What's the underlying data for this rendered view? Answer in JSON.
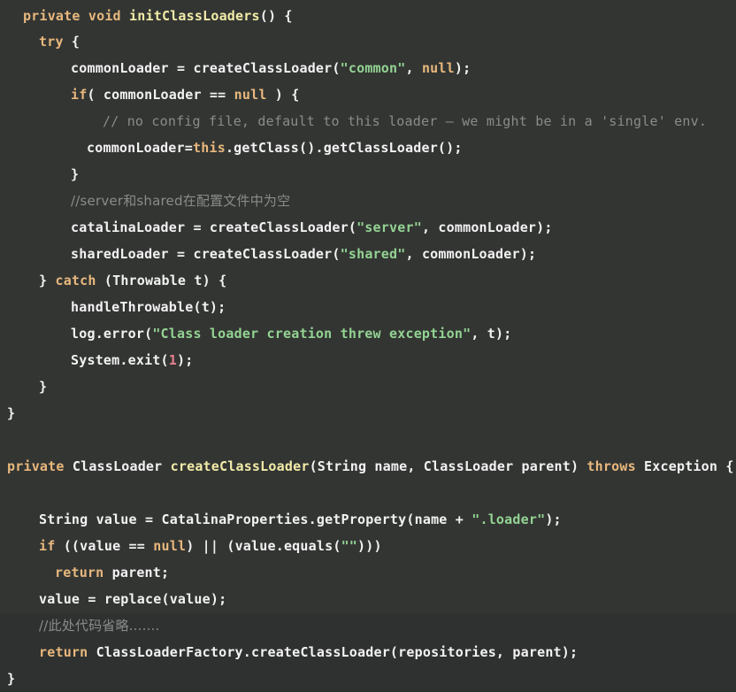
{
  "editor": {
    "background_color": "#333533",
    "language": "java",
    "theme_colors": {
      "keyword": "#e8b87d",
      "function": "#f2eca8",
      "string": "#93d393",
      "number": "#e8808f",
      "comment": "#8a8c8a",
      "plain": "#f2f2f2"
    }
  },
  "code": {
    "lines": [
      {
        "id": "line-1",
        "indent": 1,
        "tokens": [
          {
            "t": "private",
            "c": "kw"
          },
          {
            "t": " ",
            "c": "plain"
          },
          {
            "t": "void",
            "c": "kw"
          },
          {
            "t": " ",
            "c": "plain"
          },
          {
            "t": "initClassLoaders",
            "c": "fn"
          },
          {
            "t": "() {",
            "c": "plain"
          }
        ]
      },
      {
        "id": "line-2",
        "indent": 2,
        "tokens": [
          {
            "t": "try",
            "c": "kw"
          },
          {
            "t": " {",
            "c": "plain"
          }
        ]
      },
      {
        "id": "line-3",
        "indent": 4,
        "tokens": [
          {
            "t": "commonLoader = createClassLoader(",
            "c": "plain"
          },
          {
            "t": "\"common\"",
            "c": "str"
          },
          {
            "t": ", ",
            "c": "plain"
          },
          {
            "t": "null",
            "c": "kw"
          },
          {
            "t": ");",
            "c": "plain"
          }
        ]
      },
      {
        "id": "line-4",
        "indent": 4,
        "tokens": [
          {
            "t": "if",
            "c": "kw"
          },
          {
            "t": "( commonLoader == ",
            "c": "plain"
          },
          {
            "t": "null",
            "c": "kw"
          },
          {
            "t": " ) {",
            "c": "plain"
          }
        ]
      },
      {
        "id": "line-5",
        "indent": 6,
        "tokens": [
          {
            "t": "// no config file, default to this loader – we might be in a 'single' env.",
            "c": "cmt"
          }
        ]
      },
      {
        "id": "line-6",
        "indent": 5,
        "tokens": [
          {
            "t": "commonLoader=",
            "c": "plain"
          },
          {
            "t": "this",
            "c": "kw"
          },
          {
            "t": ".getClass().getClassLoader();",
            "c": "plain"
          }
        ]
      },
      {
        "id": "line-7",
        "indent": 4,
        "tokens": [
          {
            "t": "}",
            "c": "plain"
          }
        ]
      },
      {
        "id": "line-8",
        "indent": 4,
        "tokens": [
          {
            "t": "//server和shared在配置文件中为空",
            "c": "cmt-cjk"
          }
        ]
      },
      {
        "id": "line-9",
        "indent": 4,
        "tokens": [
          {
            "t": "catalinaLoader = createClassLoader(",
            "c": "plain"
          },
          {
            "t": "\"server\"",
            "c": "str"
          },
          {
            "t": ", commonLoader);",
            "c": "plain"
          }
        ]
      },
      {
        "id": "line-10",
        "indent": 4,
        "tokens": [
          {
            "t": "sharedLoader = createClassLoader(",
            "c": "plain"
          },
          {
            "t": "\"shared\"",
            "c": "str"
          },
          {
            "t": ", commonLoader);",
            "c": "plain"
          }
        ]
      },
      {
        "id": "line-11",
        "indent": 2,
        "tokens": [
          {
            "t": "} ",
            "c": "plain"
          },
          {
            "t": "catch",
            "c": "kw"
          },
          {
            "t": " (Throwable t) {",
            "c": "plain"
          }
        ]
      },
      {
        "id": "line-12",
        "indent": 4,
        "tokens": [
          {
            "t": "handleThrowable(t);",
            "c": "plain"
          }
        ]
      },
      {
        "id": "line-13",
        "indent": 4,
        "tokens": [
          {
            "t": "log.error(",
            "c": "plain"
          },
          {
            "t": "\"Class loader creation threw exception\"",
            "c": "str"
          },
          {
            "t": ", t);",
            "c": "plain"
          }
        ]
      },
      {
        "id": "line-14",
        "indent": 4,
        "tokens": [
          {
            "t": "System.exit(",
            "c": "plain"
          },
          {
            "t": "1",
            "c": "num"
          },
          {
            "t": ");",
            "c": "plain"
          }
        ]
      },
      {
        "id": "line-15",
        "indent": 2,
        "tokens": [
          {
            "t": "}",
            "c": "plain"
          }
        ]
      },
      {
        "id": "line-16",
        "indent": 0,
        "tokens": [
          {
            "t": "}",
            "c": "plain"
          }
        ]
      },
      {
        "id": "line-17",
        "indent": 0,
        "tokens": []
      },
      {
        "id": "line-18",
        "indent": 0,
        "tokens": [
          {
            "t": "private",
            "c": "kw"
          },
          {
            "t": " ClassLoader ",
            "c": "plain"
          },
          {
            "t": "createClassLoader",
            "c": "fn"
          },
          {
            "t": "(String name, ClassLoader parent) ",
            "c": "plain"
          },
          {
            "t": "throws",
            "c": "kw"
          },
          {
            "t": " Exception {",
            "c": "plain"
          }
        ]
      },
      {
        "id": "line-19",
        "indent": 0,
        "tokens": []
      },
      {
        "id": "line-20",
        "indent": 2,
        "tokens": [
          {
            "t": "String value = CatalinaProperties.getProperty(name + ",
            "c": "plain"
          },
          {
            "t": "\".loader\"",
            "c": "str"
          },
          {
            "t": ");",
            "c": "plain"
          }
        ]
      },
      {
        "id": "line-21",
        "indent": 2,
        "tokens": [
          {
            "t": "if",
            "c": "kw"
          },
          {
            "t": " ((value == ",
            "c": "plain"
          },
          {
            "t": "null",
            "c": "kw"
          },
          {
            "t": ") || (value.equals(",
            "c": "plain"
          },
          {
            "t": "\"\"",
            "c": "str"
          },
          {
            "t": ")))",
            "c": "plain"
          }
        ]
      },
      {
        "id": "line-22",
        "indent": 3,
        "tokens": [
          {
            "t": "return",
            "c": "kw"
          },
          {
            "t": " parent;",
            "c": "plain"
          }
        ]
      },
      {
        "id": "line-23",
        "indent": 2,
        "tokens": [
          {
            "t": "value = replace(value);",
            "c": "plain"
          }
        ]
      },
      {
        "id": "line-24",
        "indent": 2,
        "tokens": [
          {
            "t": "//此处代码省略.......",
            "c": "cmt-cjk"
          }
        ]
      },
      {
        "id": "line-25",
        "indent": 2,
        "tokens": [
          {
            "t": "return",
            "c": "kw"
          },
          {
            "t": " ClassLoaderFactory.createClassLoader(repositories, parent);",
            "c": "plain"
          }
        ]
      },
      {
        "id": "line-26",
        "indent": 0,
        "tokens": [
          {
            "t": "}",
            "c": "plain"
          }
        ]
      }
    ]
  }
}
